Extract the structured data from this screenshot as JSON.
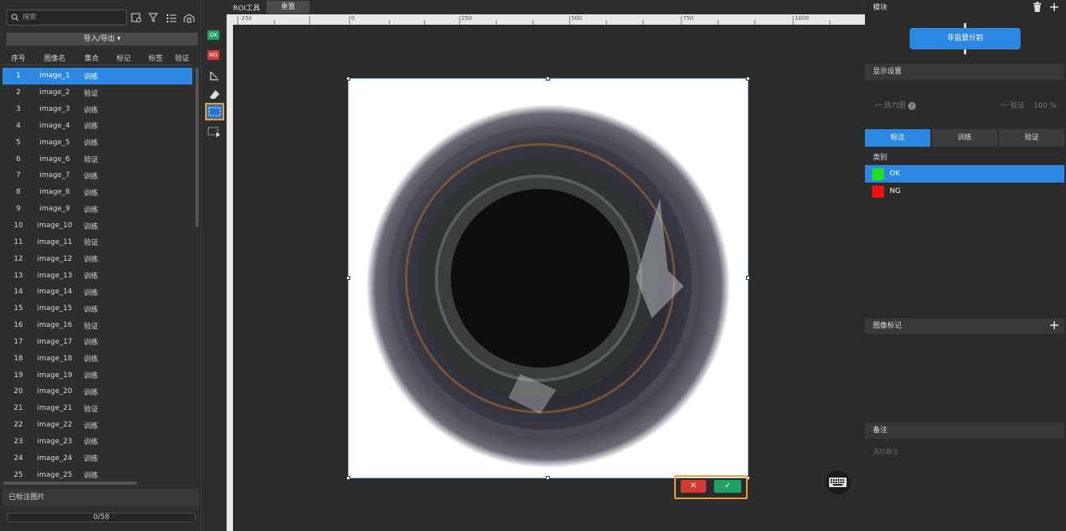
{
  "left_panel": {
    "search_placeholder": "搜索",
    "import_export": "导入/导出 ▾",
    "columns": [
      "序号",
      "图像名",
      "集合",
      "标记",
      "标签",
      "验证"
    ],
    "rows": [
      [
        "1",
        "image_1",
        "训练"
      ],
      [
        "2",
        "image_2",
        "验证"
      ],
      [
        "3",
        "image_3",
        "训练"
      ],
      [
        "4",
        "image_4",
        "训练"
      ],
      [
        "5",
        "image_5",
        "训练"
      ],
      [
        "6",
        "image_6",
        "验证"
      ],
      [
        "7",
        "image_7",
        "训练"
      ],
      [
        "8",
        "image_8",
        "训练"
      ],
      [
        "9",
        "image_9",
        "训练"
      ],
      [
        "10",
        "image_10",
        "训练"
      ],
      [
        "11",
        "image_11",
        "验证"
      ],
      [
        "12",
        "image_12",
        "训练"
      ],
      [
        "13",
        "image_13",
        "训练"
      ],
      [
        "14",
        "image_14",
        "训练"
      ],
      [
        "15",
        "image_15",
        "训练"
      ],
      [
        "16",
        "image_16",
        "验证"
      ],
      [
        "17",
        "image_17",
        "训练"
      ],
      [
        "18",
        "image_18",
        "训练"
      ],
      [
        "19",
        "image_19",
        "训练"
      ],
      [
        "20",
        "image_20",
        "训练"
      ],
      [
        "21",
        "image_21",
        "验证"
      ],
      [
        "22",
        "image_22",
        "训练"
      ],
      [
        "23",
        "image_23",
        "训练"
      ],
      [
        "24",
        "image_24",
        "训练"
      ],
      [
        "25",
        "image_25",
        "训练"
      ]
    ],
    "selected_row": 0,
    "labeled_header": "已标注图片",
    "progress_text": "0/58"
  },
  "tools": {
    "ok_tag": "OK",
    "ng_tag": "NG"
  },
  "canvas": {
    "roi_tool": "ROI工具",
    "reset": "重置",
    "ruler_labels": [
      "-250",
      "0",
      "250",
      "500",
      "750",
      "1000"
    ],
    "confirm_icon": "✓",
    "cancel_icon": "✕"
  },
  "right_panel": {
    "module_header": "模块",
    "module_button": "非监督分割",
    "display_header": "显示设置",
    "heatmap_label": "热力图",
    "verify_label": "验证",
    "verify_value": "100 %",
    "tabs": [
      "标注",
      "训练",
      "验证"
    ],
    "class_title": "类别",
    "classes": [
      {
        "name": "OK",
        "color": "#22dd22"
      },
      {
        "name": "NG",
        "color": "#ee1111"
      }
    ],
    "image_mark_header": "图像标记",
    "notes_header": "备注",
    "notes_placeholder": "添加备注"
  },
  "colors": {
    "accent": "#2c87e0",
    "highlight": "#f0a030"
  }
}
